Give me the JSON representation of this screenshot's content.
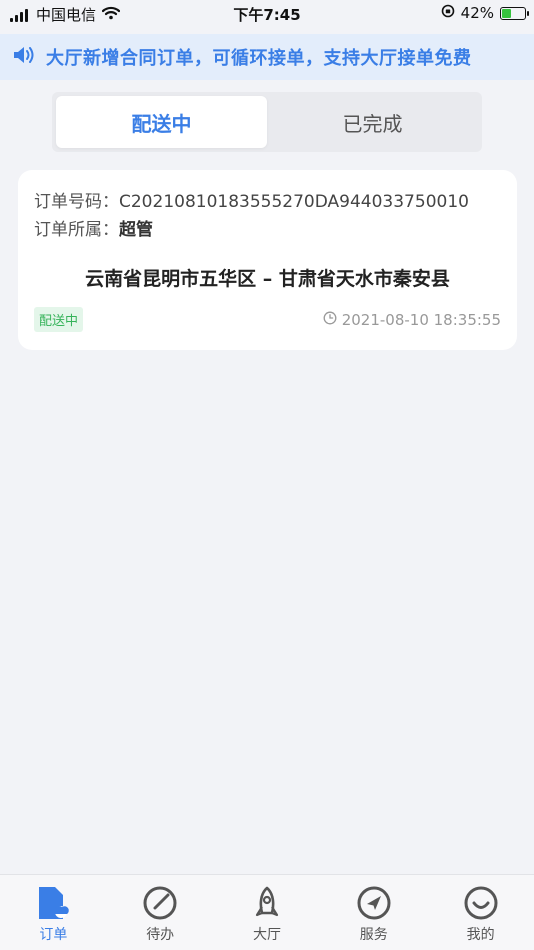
{
  "status_bar": {
    "carrier": "中国电信",
    "time": "下午7:45",
    "battery_percent": "42%",
    "battery_level": 0.42
  },
  "notice": {
    "text": "大厅新增合同订单，可循环接单，支持大厅接单免费",
    "icon": "speaker-icon"
  },
  "tabs": [
    {
      "label": "配送中",
      "active": true
    },
    {
      "label": "已完成",
      "active": false
    }
  ],
  "order": {
    "number_label": "订单号码：",
    "number": "C20210810183555270DA944033750010",
    "owner_label": "订单所属：",
    "owner": "超管",
    "route": "云南省昆明市五华区 – 甘肃省天水市秦安县",
    "status": "配送中",
    "time": "2021-08-10 18:35:55"
  },
  "bottom_nav": [
    {
      "label": "订单",
      "icon": "order-icon",
      "active": true
    },
    {
      "label": "待办",
      "icon": "todo-icon",
      "active": false
    },
    {
      "label": "大厅",
      "icon": "rocket-icon",
      "active": false
    },
    {
      "label": "服务",
      "icon": "compass-icon",
      "active": false
    },
    {
      "label": "我的",
      "icon": "smile-icon",
      "active": false
    }
  ],
  "colors": {
    "accent": "#3a7ee6",
    "background": "#f2f3f7",
    "status_green": "#36b35a"
  }
}
